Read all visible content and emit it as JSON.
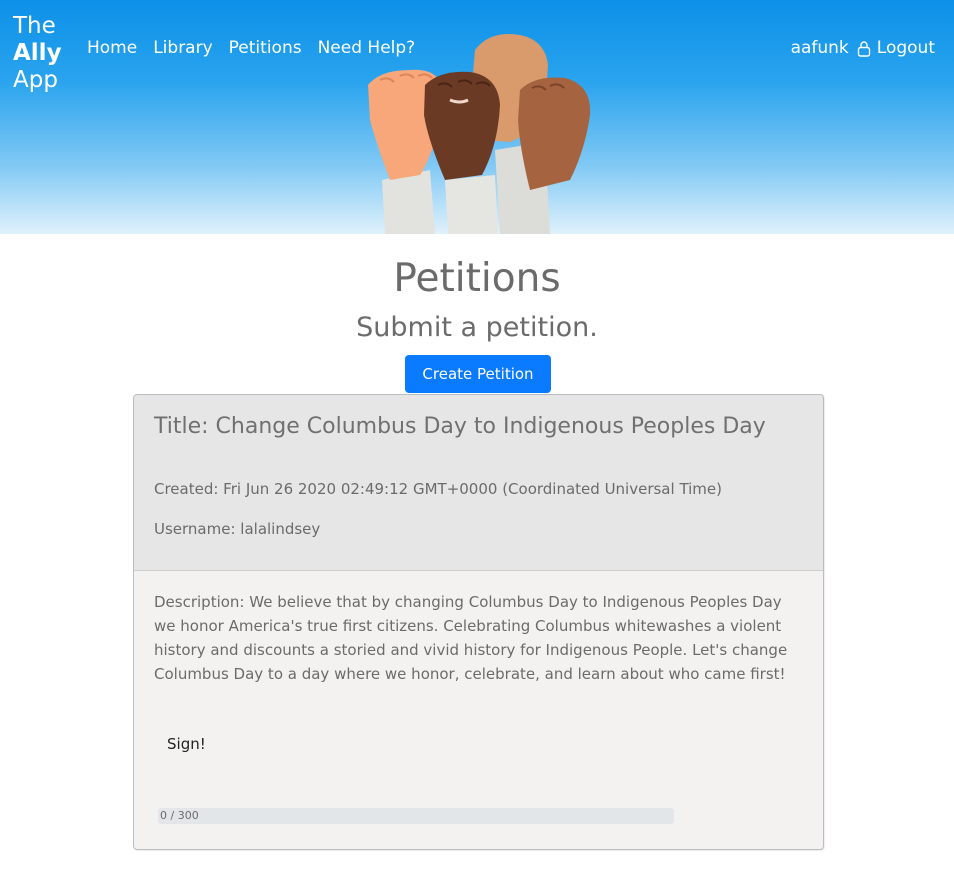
{
  "header": {
    "brand_line1": "The",
    "brand_line2": "Ally",
    "brand_line3": "App",
    "nav": [
      "Home",
      "Library",
      "Petitions",
      "Need Help?"
    ],
    "username": "aafunk",
    "logout": "Logout"
  },
  "page": {
    "title": "Petitions",
    "subtitle": "Submit a petition.",
    "create_button": "Create Petition"
  },
  "petition": {
    "title": "Title: Change Columbus Day to Indigenous Peoples Day",
    "created": "Created: Fri Jun 26 2020 02:49:12 GMT+0000 (Coordinated Universal Time)",
    "username": "Username: lalalindsey",
    "description": "Description: We believe that by changing Columbus Day to Indigenous Peoples Day we honor America's true first citizens. Celebrating Columbus whitewashes a violent history and discounts a storied and vivid history for Indigenous People. Let's change Columbus Day to a day where we honor, celebrate, and learn about who came first!",
    "sign_label": "Sign!",
    "signatures": 0,
    "goal": 300,
    "progress_text": "0 / 300"
  },
  "colors": {
    "accent": "#0a7aff",
    "hero_top": "#0c90e8",
    "card_header": "#e7e6e7",
    "card_body": "#f4f2f1"
  }
}
